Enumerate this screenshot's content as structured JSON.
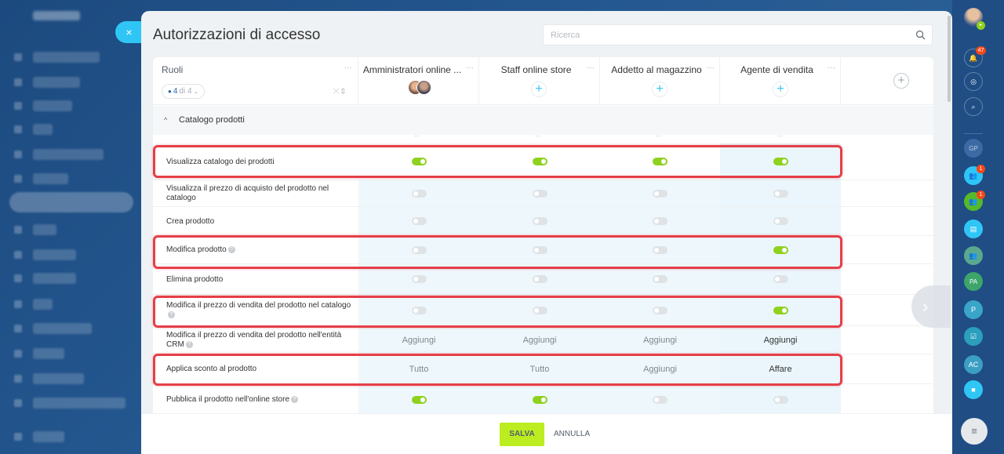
{
  "panel": {
    "title": "Autorizzazioni di accesso",
    "close_label": "×",
    "search_placeholder": "Ricerca"
  },
  "header": {
    "roles_label": "Ruoli",
    "roles_count": "4",
    "roles_of": "di 4",
    "columns": [
      {
        "title": "Amministratori online ...",
        "has_avatars": true
      },
      {
        "title": "Staff online store",
        "has_avatars": false
      },
      {
        "title": "Addetto al magazzino",
        "has_avatars": false
      },
      {
        "title": "Agente di vendita",
        "has_avatars": false
      }
    ],
    "add_column_label": "+",
    "plus_label": "+",
    "dots_label": "···"
  },
  "section": {
    "label": "Catalogo prodotti"
  },
  "rows": [
    {
      "label": "Visualizza catalogo dei prodotti",
      "help": false,
      "cells": [
        {
          "type": "toggle",
          "on": true
        },
        {
          "type": "toggle",
          "on": true
        },
        {
          "type": "toggle",
          "on": true
        },
        {
          "type": "toggle",
          "on": true
        }
      ]
    },
    {
      "label": "Visualizza il prezzo di acquisto del prodotto nel catalogo",
      "help": false,
      "cells": [
        {
          "type": "toggle",
          "on": false
        },
        {
          "type": "toggle",
          "on": false
        },
        {
          "type": "toggle",
          "on": false
        },
        {
          "type": "toggle",
          "on": false
        }
      ]
    },
    {
      "label": "Crea prodotto",
      "help": false,
      "cells": [
        {
          "type": "toggle",
          "on": false
        },
        {
          "type": "toggle",
          "on": false
        },
        {
          "type": "toggle",
          "on": false
        },
        {
          "type": "toggle",
          "on": false
        }
      ]
    },
    {
      "label": "Modifica prodotto",
      "help": true,
      "cells": [
        {
          "type": "toggle",
          "on": false
        },
        {
          "type": "toggle",
          "on": false
        },
        {
          "type": "toggle",
          "on": false
        },
        {
          "type": "toggle",
          "on": true
        }
      ]
    },
    {
      "label": "Elimina prodotto",
      "help": false,
      "cells": [
        {
          "type": "toggle",
          "on": false
        },
        {
          "type": "toggle",
          "on": false
        },
        {
          "type": "toggle",
          "on": false
        },
        {
          "type": "toggle",
          "on": false
        }
      ]
    },
    {
      "label": "Modifica il prezzo di vendita del prodotto nel catalogo",
      "help": true,
      "cells": [
        {
          "type": "toggle",
          "on": false
        },
        {
          "type": "toggle",
          "on": false
        },
        {
          "type": "toggle",
          "on": false
        },
        {
          "type": "toggle",
          "on": true
        }
      ]
    },
    {
      "label": "Modifica il prezzo di vendita del prodotto nell'entità CRM",
      "help": true,
      "cells": [
        {
          "type": "text",
          "value": "Aggiungi"
        },
        {
          "type": "text",
          "value": "Aggiungi"
        },
        {
          "type": "text",
          "value": "Aggiungi"
        },
        {
          "type": "text",
          "value": "Aggiungi",
          "dark": true
        }
      ]
    },
    {
      "label": "Applica sconto al prodotto",
      "help": false,
      "cells": [
        {
          "type": "text",
          "value": "Tutto"
        },
        {
          "type": "text",
          "value": "Tutto"
        },
        {
          "type": "text",
          "value": "Aggiungi"
        },
        {
          "type": "text",
          "value": "Affare",
          "dark": true
        }
      ]
    },
    {
      "label": "Pubblica il prodotto nell'online store",
      "help": true,
      "cells": [
        {
          "type": "toggle",
          "on": true
        },
        {
          "type": "toggle",
          "on": true
        },
        {
          "type": "toggle",
          "on": false
        },
        {
          "type": "toggle",
          "on": false
        }
      ]
    }
  ],
  "footer": {
    "save_label": "SALVA",
    "cancel_label": "ANNULLA"
  },
  "right_bar": {
    "notifications_badge": "47",
    "badge_1": "1",
    "badge_2": "1",
    "user_initials": [
      "GP",
      "PA",
      "P",
      "AC"
    ]
  },
  "colors": {
    "toggle_on": "#8fd11f",
    "toggle_off": "#dfe3e6",
    "accent": "#2fc6f6",
    "save": "#bbed21",
    "highlight": "#e53f48"
  }
}
